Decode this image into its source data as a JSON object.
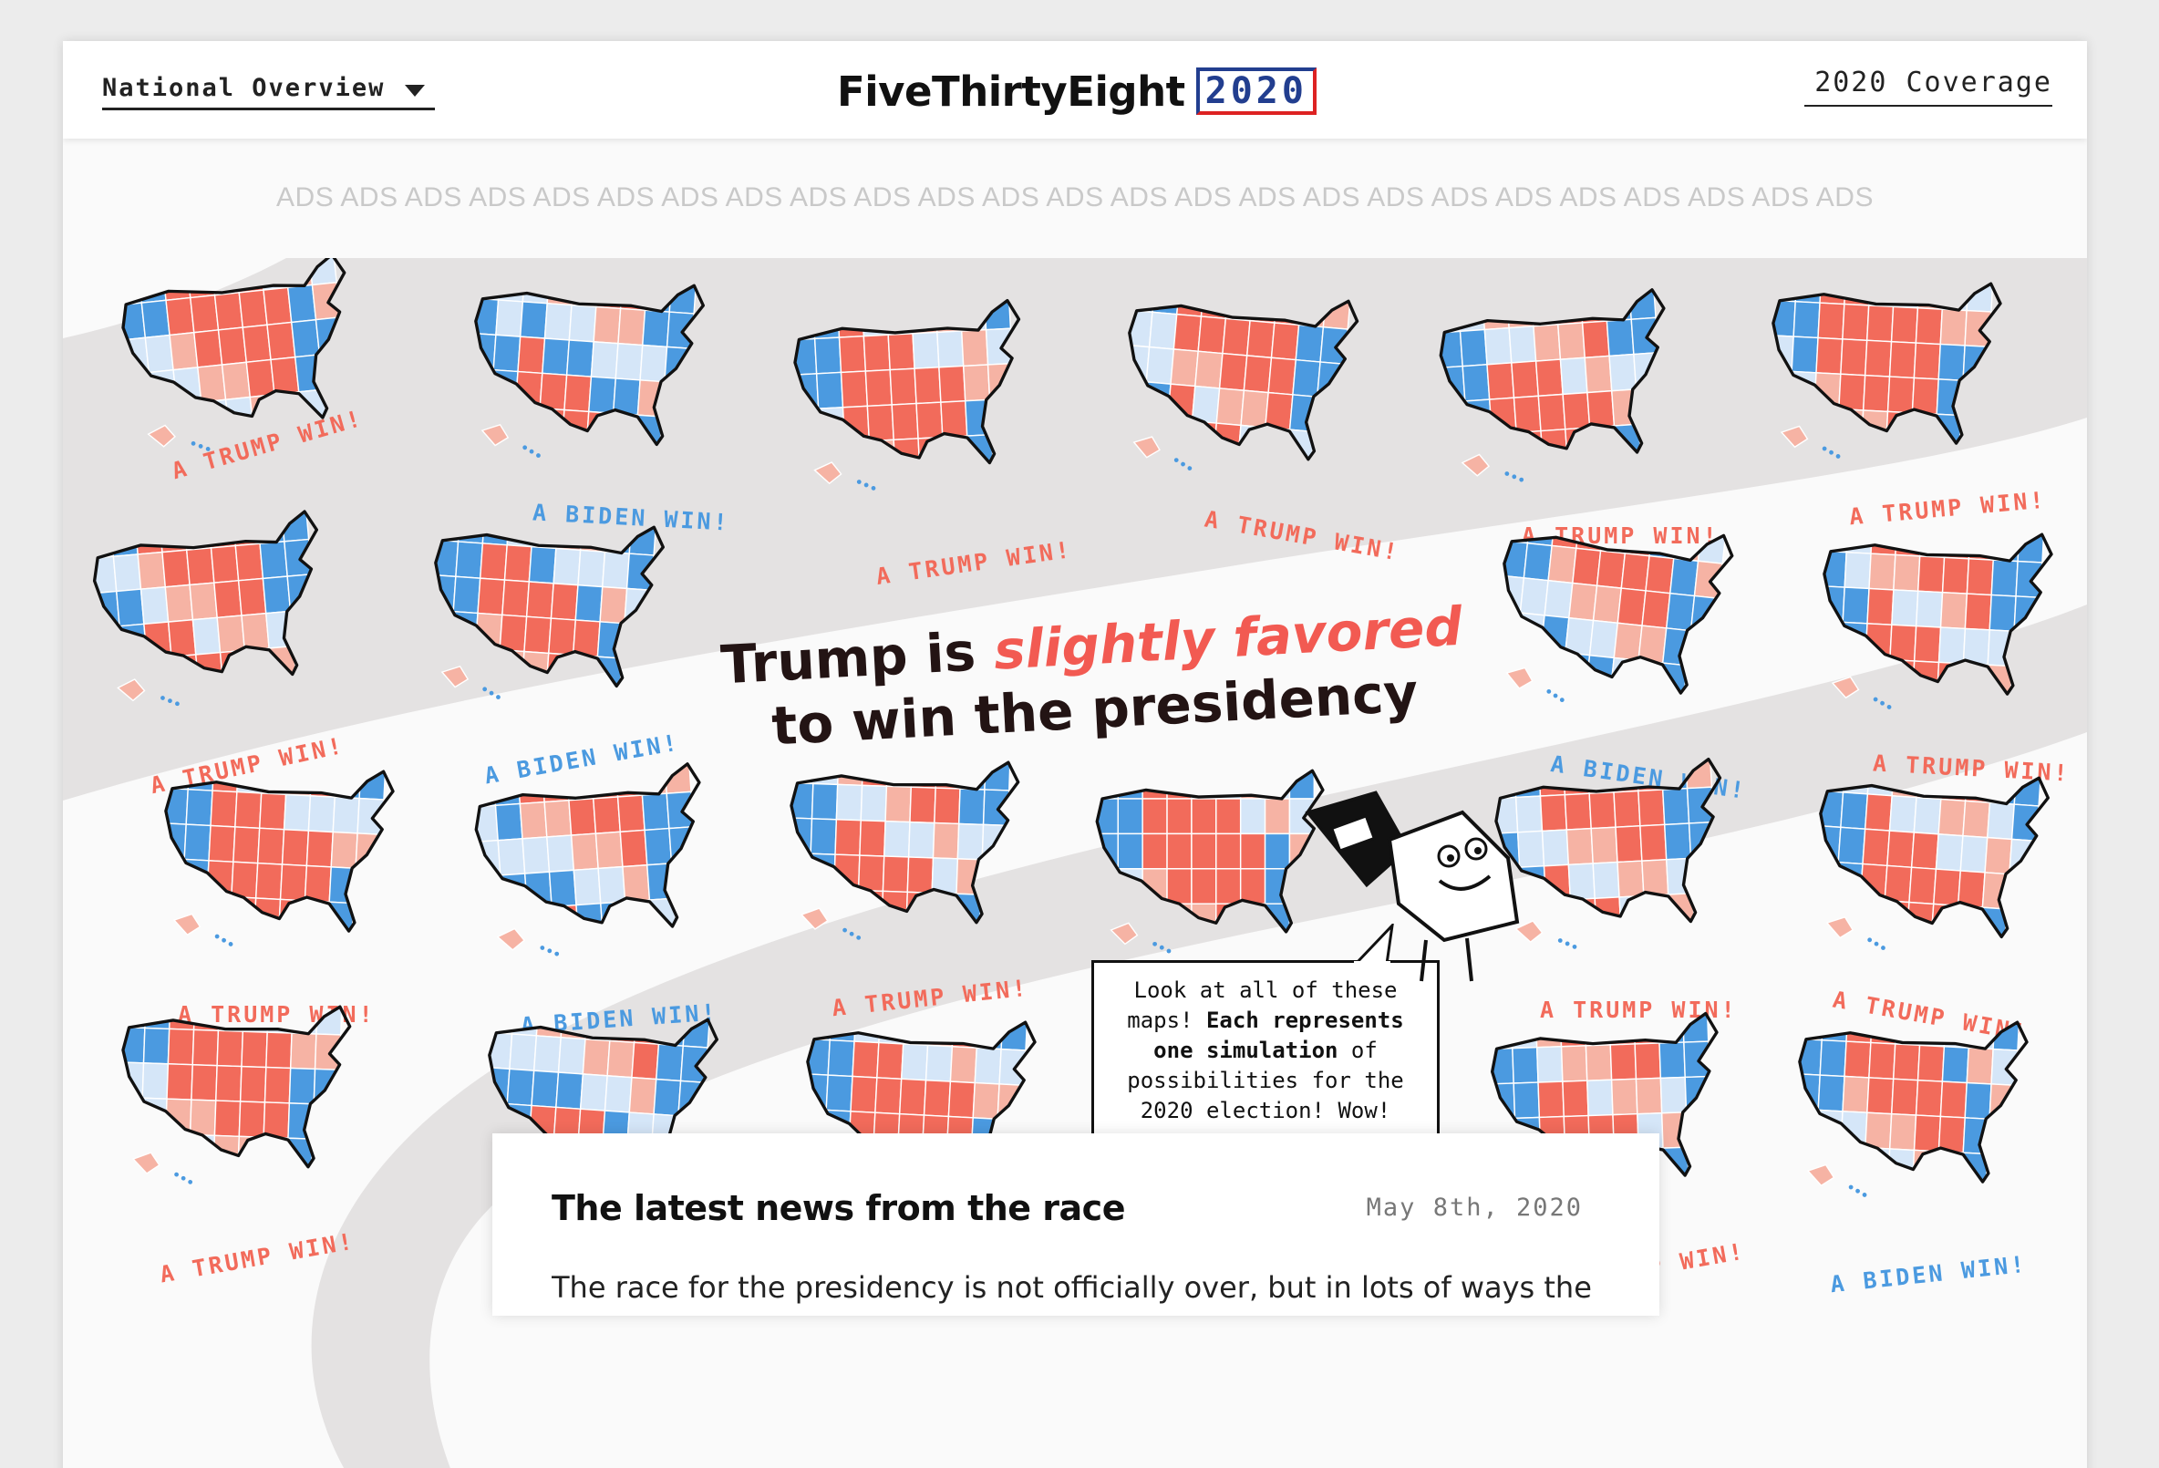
{
  "header": {
    "nav_select": "National Overview",
    "logo_word": "FiveThirtyEight",
    "logo_year": "2020",
    "coverage_link": "2020 Coverage"
  },
  "ads_banner": "ADS ADS ADS ADS ADS ADS ADS ADS ADS ADS ADS ADS ADS ADS ADS ADS ADS ADS ADS ADS ADS ADS ADS ADS ADS",
  "hero": {
    "headline_pre": "Trump is ",
    "headline_emph": "slightly favored",
    "headline_post": "to win the presidency",
    "speech_1": "Look at all of these maps! ",
    "speech_bold": "Each represents one simulation",
    "speech_2": " of possibilities for the 2020 election! Wow!",
    "colors": {
      "trump": "#f26b5b",
      "trump_light": "#f6b3a4",
      "biden": "#4b9ae0",
      "biden_light": "#d5e6f8",
      "band": "#e4e2e2"
    },
    "maps": [
      {
        "outcome": "trump",
        "label": "A TRUMP WIN!"
      },
      {
        "outcome": "biden",
        "label": "A BIDEN WIN!"
      },
      {
        "outcome": "trump",
        "label": "A TRUMP WIN!"
      },
      {
        "outcome": "trump",
        "label": "A TRUMP WIN!"
      },
      {
        "outcome": "trump",
        "label": "A TRUMP WIN!"
      },
      {
        "outcome": "trump",
        "label": "A TRUMP WIN!"
      },
      {
        "outcome": "trump",
        "label": "A TRUMP WIN!"
      },
      {
        "outcome": "biden",
        "label": "A BIDEN WIN!"
      },
      {
        "outcome": "biden",
        "label": "A BIDEN WIN!"
      },
      {
        "outcome": "trump",
        "label": "A TRUMP WIN!"
      },
      {
        "outcome": "trump",
        "label": "A TRUMP WIN!"
      },
      {
        "outcome": "biden",
        "label": "A BIDEN WIN!"
      },
      {
        "outcome": "trump",
        "label": "A TRUMP WIN!"
      },
      {
        "outcome": "trump",
        "label": "A TRUMP WIN!"
      },
      {
        "outcome": "trump",
        "label": "A TRUMP WIN!"
      },
      {
        "outcome": "trump",
        "label": "A TRUMP WIN!"
      },
      {
        "outcome": "trump",
        "label": "A TRUMP WIN!"
      },
      {
        "outcome": "biden",
        "label": "A BIDEN WIN!"
      },
      {
        "outcome": "trump",
        "label": "A TRUMP WIN!"
      },
      {
        "outcome": "trump",
        "label": "A TRUMP WIN!"
      },
      {
        "outcome": "trump",
        "label": "A TRUMP WIN!"
      },
      {
        "outcome": "biden",
        "label": "A BIDEN WIN!"
      }
    ]
  },
  "news": {
    "title": "The latest news from the race",
    "date": "May 8th, 2020",
    "body": "The race for the presidency is not officially over, but in lots of ways the"
  }
}
